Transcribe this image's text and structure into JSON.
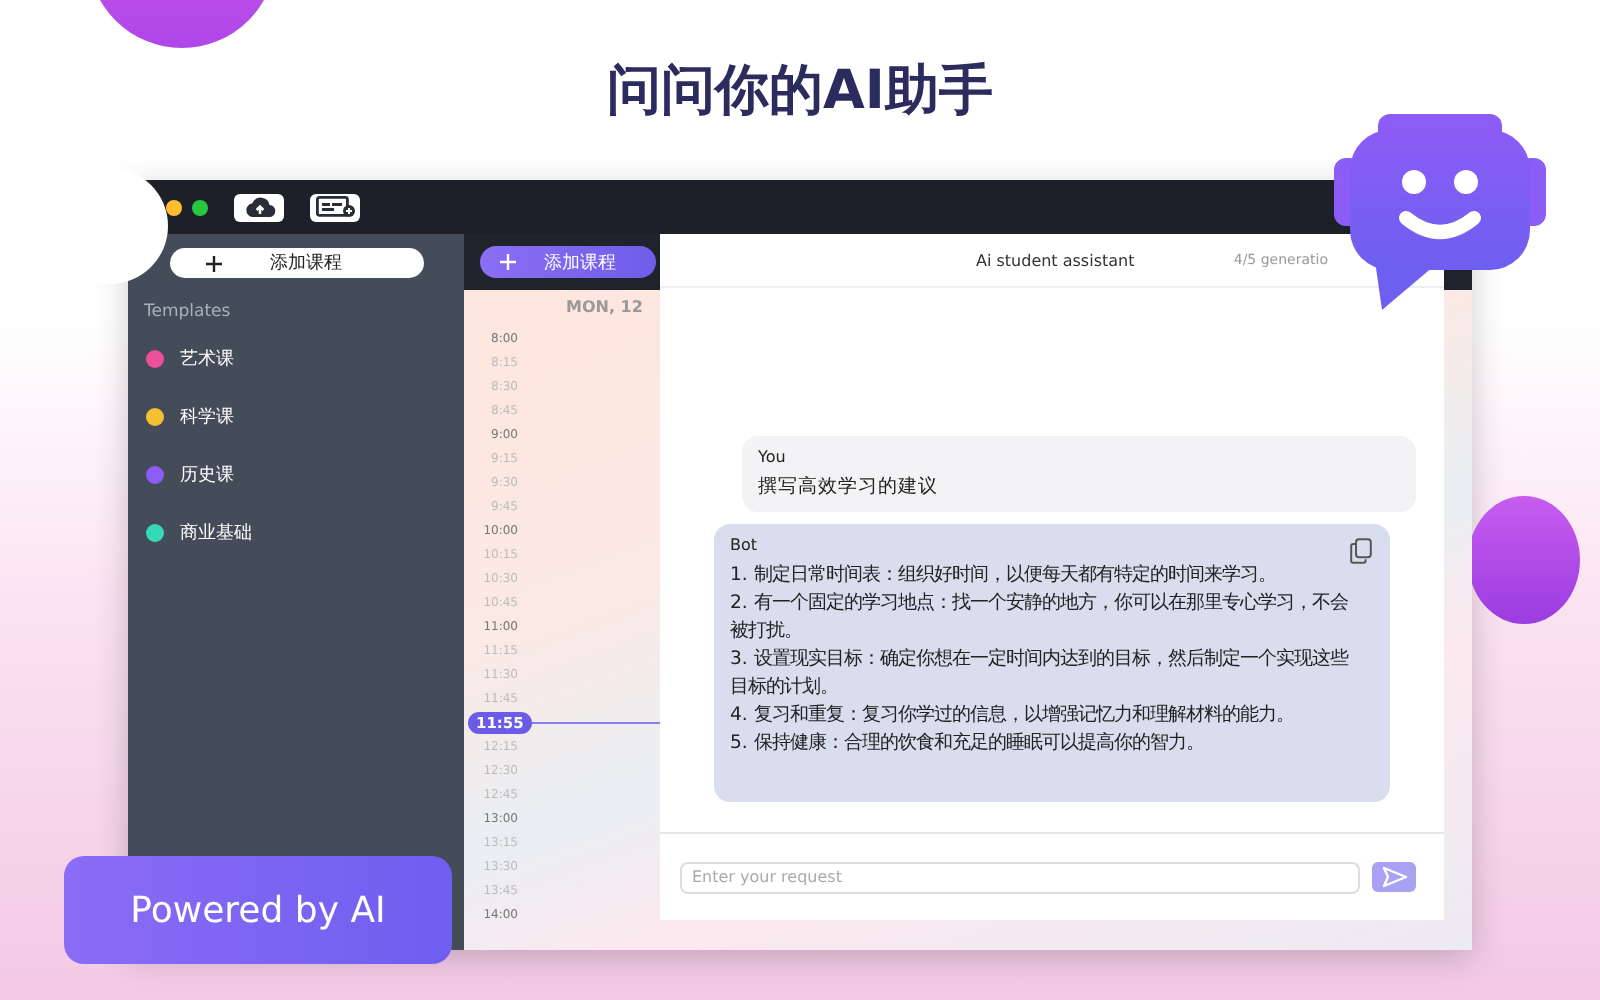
{
  "headline": "问问你的AI助手",
  "badge": "Powered by AI",
  "sidebar": {
    "add_button": "添加课程",
    "section": "Templates",
    "items": [
      {
        "label": "艺术课",
        "color": "#ec4f9c"
      },
      {
        "label": "科学课",
        "color": "#f6c033"
      },
      {
        "label": "历史课",
        "color": "#8b5cf6"
      },
      {
        "label": "商业基础",
        "color": "#34d9b8"
      }
    ]
  },
  "toolbar": {
    "add_button": "添加课程"
  },
  "calendar": {
    "day": "MON, 12",
    "times": [
      {
        "time": "8:00",
        "kind": "hour"
      },
      {
        "time": "8:15",
        "kind": "quarter"
      },
      {
        "time": "8:30",
        "kind": "quarter"
      },
      {
        "time": "8:45",
        "kind": "quarter"
      },
      {
        "time": "9:00",
        "kind": "hour"
      },
      {
        "time": "9:15",
        "kind": "quarter"
      },
      {
        "time": "9:30",
        "kind": "quarter"
      },
      {
        "time": "9:45",
        "kind": "quarter"
      },
      {
        "time": "10:00",
        "kind": "hour"
      },
      {
        "time": "10:15",
        "kind": "quarter"
      },
      {
        "time": "10:30",
        "kind": "quarter"
      },
      {
        "time": "10:45",
        "kind": "quarter"
      },
      {
        "time": "11:00",
        "kind": "hour"
      },
      {
        "time": "11:15",
        "kind": "quarter"
      },
      {
        "time": "11:30",
        "kind": "quarter"
      },
      {
        "time": "11:45",
        "kind": "quarter"
      },
      {
        "time": "11:55",
        "kind": "now"
      },
      {
        "time": "12:15",
        "kind": "quarter"
      },
      {
        "time": "12:30",
        "kind": "quarter"
      },
      {
        "time": "12:45",
        "kind": "quarter"
      },
      {
        "time": "13:00",
        "kind": "hour"
      },
      {
        "time": "13:15",
        "kind": "quarter"
      },
      {
        "time": "13:30",
        "kind": "quarter"
      },
      {
        "time": "13:45",
        "kind": "quarter"
      },
      {
        "time": "14:00",
        "kind": "hour"
      }
    ]
  },
  "chat": {
    "title": "Ai student assistant",
    "quota": "4/5 generatio",
    "messages": [
      {
        "kind": "user",
        "sender": "You",
        "lines": [
          "撰写高效学习的建议"
        ]
      },
      {
        "kind": "bot",
        "sender": "Bot",
        "lines": [
          "1. 制定日常时间表：组织好时间，以便每天都有特定的时间来学习。",
          "2. 有一个固定的学习地点：找一个安静的地方，你可以在那里专心学习，不会被打扰。",
          "3. 设置现实目标：确定你想在一定时间内达到的目标，然后制定一个实现这些目标的计划。",
          "4. 复习和重复：复习你学过的信息，以增强记忆力和理解材料的能力。",
          "5. 保持健康：合理的饮食和充足的睡眠可以提高你的智力。"
        ]
      }
    ],
    "input": {
      "placeholder": "Enter your request"
    }
  }
}
